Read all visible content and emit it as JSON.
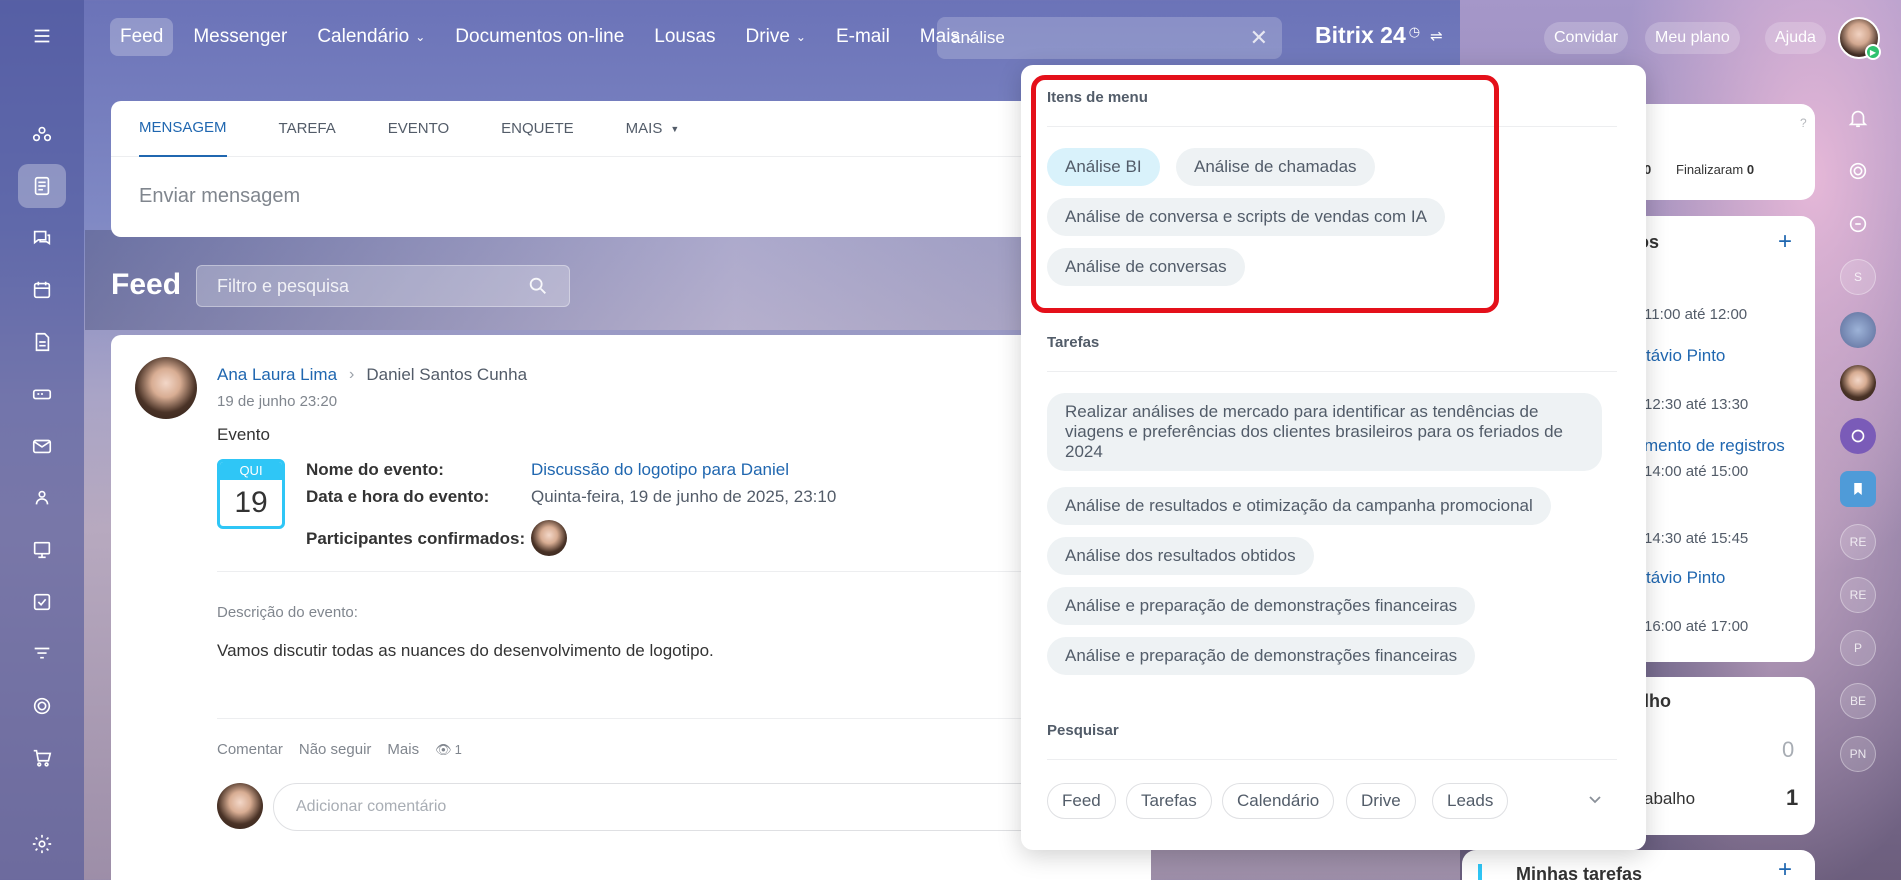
{
  "topnav": {
    "items": [
      {
        "label": "Feed",
        "active": true,
        "dropdown": false
      },
      {
        "label": "Messenger",
        "active": false,
        "dropdown": false
      },
      {
        "label": "Calendário",
        "active": false,
        "dropdown": true
      },
      {
        "label": "Documentos on-line",
        "active": false,
        "dropdown": false
      },
      {
        "label": "Lousas",
        "active": false,
        "dropdown": false
      },
      {
        "label": "Drive",
        "active": false,
        "dropdown": true
      },
      {
        "label": "E-mail",
        "active": false,
        "dropdown": false
      },
      {
        "label": "Mais",
        "active": false,
        "dropdown": true
      }
    ],
    "search_value": "análise",
    "brand": "Bitrix 24",
    "invite": "Convidar",
    "plan": "Meu plano",
    "help": "Ajuda"
  },
  "composer": {
    "tabs": [
      "MENSAGEM",
      "TAREFA",
      "EVENTO",
      "ENQUETE",
      "MAIS"
    ],
    "placeholder": "Enviar mensagem"
  },
  "feed": {
    "title": "Feed",
    "filter_placeholder": "Filtro e pesquisa"
  },
  "post": {
    "author": "Ana Laura Lima",
    "recipient": "Daniel Santos Cunha",
    "date": "19 de junho 23:20",
    "type": "Evento",
    "calendar": {
      "weekday": "QUI",
      "day": "19"
    },
    "event_name_label": "Nome do evento:",
    "event_name": "Discussão do logotipo para Daniel",
    "event_datetime_label": "Data e hora do evento:",
    "event_datetime": "Quinta-feira, 19 de junho de 2025, 23:10",
    "participants_label": "Participantes confirmados:",
    "description_label": "Descrição do evento:",
    "description": "Vamos discutir todas as nuances do desenvolvimento de logotipo.",
    "actions": {
      "comment": "Comentar",
      "unfollow": "Não seguir",
      "more": "Mais",
      "views": "1"
    },
    "comment_placeholder": "Adicionar comentário"
  },
  "right_widgets": {
    "tasks_finished_label": "Finalizaram",
    "tasks_finished": "0",
    "tasks_zero": "0",
    "events_title_partial": "os",
    "events": [
      {
        "time": "11:00 até 12:00",
        "title": "távio Pinto"
      },
      {
        "time": "12:30 até 13:30",
        "title": "mento de registros"
      },
      {
        "time": "14:00 até 15:00",
        "title": ""
      },
      {
        "time": "14:30 até 15:45",
        "title": "távio Pinto"
      },
      {
        "time": "16:00 até 17:00",
        "title": ""
      }
    ],
    "work_title_partial": "lho",
    "work_value_1": "0",
    "work_label_2": "abalho",
    "work_value_2": "1",
    "my_tasks": "Minhas tarefas"
  },
  "right_rail": {
    "initials": [
      "S",
      "RE",
      "RE",
      "P",
      "BE",
      "PN"
    ]
  },
  "dropdown": {
    "menu_items_title": "Itens de menu",
    "menu_items": [
      "Análise BI",
      "Análise de chamadas",
      "Análise de conversa e scripts de vendas com IA",
      "Análise de conversas"
    ],
    "tasks_title": "Tarefas",
    "tasks": [
      "Realizar análises de mercado para identificar as tendências de viagens e preferências dos clientes brasileiros para os feriados de 2024",
      "Análise de resultados e otimização da campanha promocional",
      "Análise dos resultados obtidos",
      "Análise e preparação de demonstrações financeiras",
      "Análise e preparação de demonstrações financeiras"
    ],
    "search_title": "Pesquisar",
    "search_scopes": [
      "Feed",
      "Tarefas",
      "Calendário",
      "Drive",
      "Leads"
    ]
  },
  "colors": {
    "accent": "#2067b0",
    "highlight": "#e4101a",
    "calendar": "#2fc6f6"
  }
}
